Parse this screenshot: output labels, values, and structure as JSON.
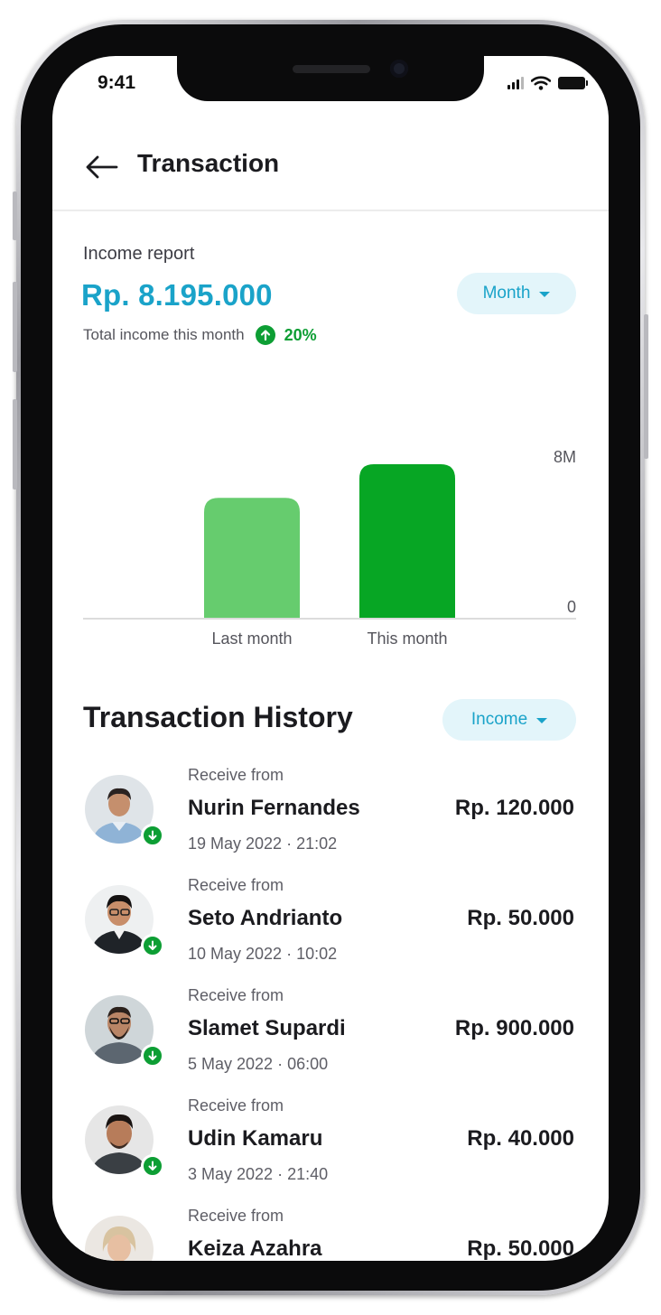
{
  "status_bar": {
    "time": "9:41"
  },
  "header": {
    "title": "Transaction",
    "back_icon": "arrow-left-icon"
  },
  "income_report": {
    "label": "Income report",
    "amount": "Rp. 8.195.000",
    "subtitle": "Total income this month",
    "change_icon": "arrow-up-circle-icon",
    "change_percent": "20%",
    "period_filter": "Month"
  },
  "chart_data": {
    "type": "bar",
    "categories": [
      "Last month",
      "This month"
    ],
    "values": [
      6.4,
      8.195
    ],
    "unit": "M",
    "ylim": [
      0,
      8.195
    ],
    "y_tick_labels": [
      {
        "value": 8,
        "label": "8M"
      },
      {
        "value": 0,
        "label": "0"
      }
    ],
    "colors": [
      "#66cc6e",
      "#07a624"
    ],
    "grid": false
  },
  "history": {
    "title": "Transaction History",
    "type_filter": "Income",
    "items": [
      {
        "kind": "Receive from",
        "name": "Nurin Fernandes",
        "date": "19 May 2022",
        "time": "21:02",
        "amount": "Rp. 120.000"
      },
      {
        "kind": "Receive from",
        "name": "Seto Andrianto",
        "date": "10 May 2022",
        "time": "10:02",
        "amount": "Rp. 50.000"
      },
      {
        "kind": "Receive from",
        "name": "Slamet Supardi",
        "date": "5 May 2022",
        "time": "06:00",
        "amount": "Rp. 900.000"
      },
      {
        "kind": "Receive from",
        "name": "Udin Kamaru",
        "date": "3 May 2022",
        "time": "21:40",
        "amount": "Rp. 40.000"
      },
      {
        "kind": "Receive from",
        "name": "Keiza Azahra",
        "date": "",
        "time": "",
        "amount": "Rp. 50.000"
      }
    ]
  },
  "colors": {
    "accent": "#1aa3c9",
    "accent_bg": "#e3f5fa",
    "positive": "#0d9e34"
  }
}
